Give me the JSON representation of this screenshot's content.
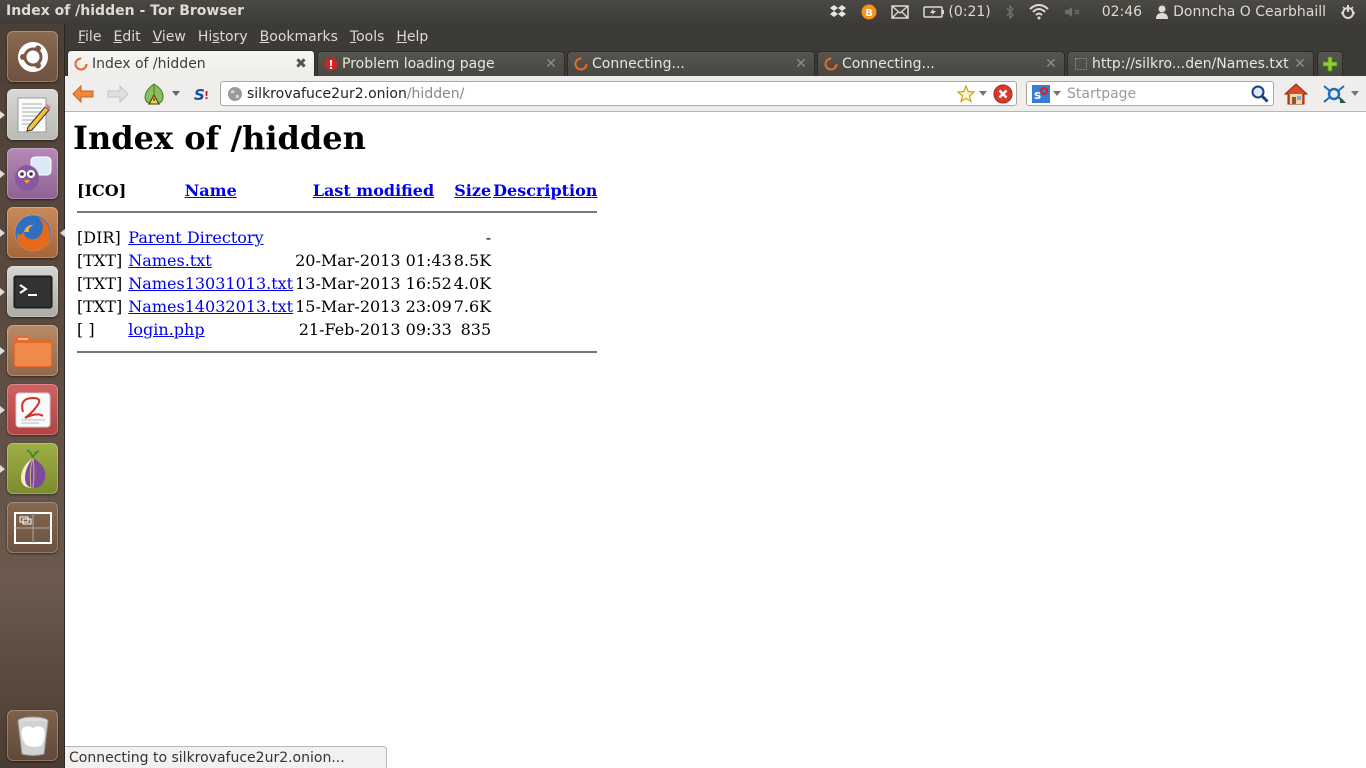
{
  "window": {
    "title": "Index of /hidden - Tor Browser"
  },
  "top_panel": {
    "indicators": [
      {
        "icon": "dropbox-icon"
      },
      {
        "icon": "bitcoin-icon"
      },
      {
        "icon": "mail-icon"
      },
      {
        "icon": "battery-icon",
        "text": "(0:21)"
      },
      {
        "icon": "bluetooth-icon"
      },
      {
        "icon": "wifi-icon"
      },
      {
        "icon": "volume-muted-icon"
      }
    ],
    "clock": "02:46",
    "user": "Donncha O Cearbhaill",
    "power_icon": "power-gear-icon"
  },
  "launcher": {
    "items": [
      {
        "name": "ubuntu-dash",
        "icon": "ubuntu-logo-icon"
      },
      {
        "name": "text-editor",
        "icon": "text-editor-icon",
        "running": true
      },
      {
        "name": "pidgin",
        "icon": "pidgin-icon",
        "running": true
      },
      {
        "name": "firefox",
        "icon": "firefox-icon",
        "running": true,
        "focused": true
      },
      {
        "name": "terminal",
        "icon": "terminal-icon",
        "running": true
      },
      {
        "name": "files",
        "icon": "folder-icon",
        "running": true
      },
      {
        "name": "document-viewer",
        "icon": "document-viewer-icon",
        "running": true
      },
      {
        "name": "tor-browser",
        "icon": "tor-onion-icon",
        "running": true
      },
      {
        "name": "workspace-switcher",
        "icon": "workspace-switcher-icon"
      },
      {
        "name": "trash",
        "icon": "trash-icon"
      }
    ]
  },
  "menubar": {
    "items": [
      {
        "label": "File",
        "accel": "F",
        "rest": "ile"
      },
      {
        "label": "Edit",
        "accel": "E",
        "rest": "dit"
      },
      {
        "label": "View",
        "accel": "V",
        "rest": "iew"
      },
      {
        "label": "History",
        "pre": "Hi",
        "accel": "s",
        "rest": "tory"
      },
      {
        "label": "Bookmarks",
        "accel": "B",
        "rest": "ookmarks"
      },
      {
        "label": "Tools",
        "accel": "T",
        "rest": "ools"
      },
      {
        "label": "Help",
        "accel": "H",
        "rest": "elp"
      }
    ]
  },
  "tabs": [
    {
      "title": "Index of /hidden",
      "icon": "loading-spinner-icon",
      "active": true
    },
    {
      "title": "Problem loading page",
      "icon": "error-icon",
      "active": false
    },
    {
      "title": "Connecting...",
      "icon": "loading-spinner-icon",
      "active": false
    },
    {
      "title": "Connecting...",
      "icon": "loading-spinner-icon",
      "active": false
    },
    {
      "title": "http://silkro...den/Names.txt",
      "icon": "blank-page-icon",
      "active": false
    }
  ],
  "new_tab_icon": "plus-icon",
  "navbar": {
    "url_host": "silkrovafuce2ur2.onion",
    "url_path": "/hidden/",
    "search_placeholder": "Startpage",
    "search_value": ""
  },
  "page": {
    "heading": "Index of /hidden",
    "columns": {
      "icon": "[ICO]",
      "name": "Name",
      "modified": "Last modified",
      "size": "Size",
      "description": "Description"
    },
    "rows": [
      {
        "type": "[DIR]",
        "name": "Parent Directory",
        "modified": "",
        "size": "-",
        "description": ""
      },
      {
        "type": "[TXT]",
        "name": "Names.txt",
        "modified": "20-Mar-2013 01:43",
        "size": "8.5K",
        "description": ""
      },
      {
        "type": "[TXT]",
        "name": "Names13031013.txt",
        "modified": "13-Mar-2013 16:52",
        "size": "4.0K",
        "description": ""
      },
      {
        "type": "[TXT]",
        "name": "Names14032013.txt",
        "modified": "15-Mar-2013 23:09",
        "size": "7.6K",
        "description": ""
      },
      {
        "type": "[ ]",
        "name": "login.php",
        "modified": "21-Feb-2013 09:33",
        "size": "835",
        "description": ""
      }
    ]
  },
  "status": {
    "text": "Connecting to silkrovafuce2ur2.onion..."
  }
}
